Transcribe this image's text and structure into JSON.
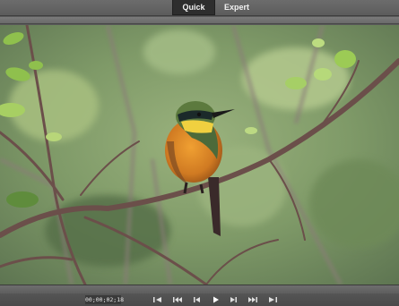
{
  "header": {
    "tabs": [
      {
        "label": "Quick",
        "active": true
      },
      {
        "label": "Expert",
        "active": false
      }
    ]
  },
  "player": {
    "timecode": "00;00;02;18",
    "controls": [
      {
        "icon": "go-to-in-point-icon"
      },
      {
        "icon": "skip-to-start-icon"
      },
      {
        "icon": "step-back-icon"
      },
      {
        "icon": "play-icon"
      },
      {
        "icon": "step-forward-icon"
      },
      {
        "icon": "skip-to-end-icon"
      },
      {
        "icon": "go-to-out-point-icon"
      }
    ]
  },
  "colors": {
    "accent": "#2e2e2e",
    "panel": "#5c5c5c"
  }
}
